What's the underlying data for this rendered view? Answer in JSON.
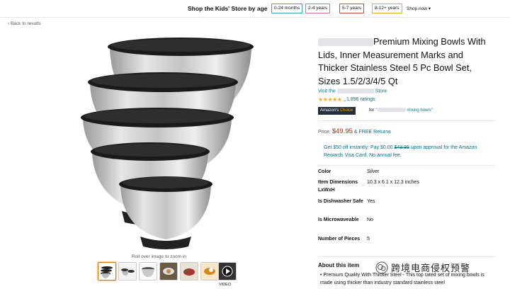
{
  "top_bar": {
    "label": "Shop the Kids' Store by age",
    "age_chips": [
      {
        "label": "0-24 months",
        "color": "#3aa2c9"
      },
      {
        "label": "2-4 years",
        "color": "#d86d9b"
      },
      {
        "label": "5-7 years",
        "color": "#e23c3c"
      },
      {
        "label": "8-12+ years",
        "color": "#e9b21c"
      }
    ],
    "shop_now": "Shop now ▾"
  },
  "back_link": "‹ Back to results",
  "gallery": {
    "roll_over_text": "Roll over image to zoom in",
    "thumbnail_count": 7,
    "video_label": "VIDEO"
  },
  "product": {
    "title": "Premium Mixing Bowls With Lids, Inner Measurement Marks and Thicker Stainless Steel 5 Pc Bowl Set, Sizes 1.5/2/3/4/5 Qt",
    "visit_prefix": "Visit the",
    "visit_suffix": "Store",
    "rating_stars": "★★★★★",
    "rating_value": 5,
    "rating_chevron": "⌄",
    "ratings_count": "1,896 ratings",
    "choice_badge_prefix": "Amazon's",
    "choice_badge_suffix": "Choice",
    "choice_for": "for",
    "choice_link": "mixing bowls\"",
    "price_label": "Price:",
    "price": "$49.95",
    "free_returns": "& FREE Returns",
    "promo_part1": "Get $50 off instantly: Pay $0.00",
    "promo_strike": "$49.95",
    "promo_part2": "upon approval for the Amazon Rewards Visa Card. No annual fee."
  },
  "specs": [
    {
      "label": "Color",
      "value": "Silver"
    },
    {
      "label": "Item Dimensions LxWxH",
      "value": "10.3 x 6.1 x 12.3 inches"
    },
    {
      "label": "Is Dishwasher Safe",
      "value": "Yes"
    },
    {
      "label": "Is Microwaveable",
      "value": "No"
    },
    {
      "label": "Number of Pieces",
      "value": "5"
    }
  ],
  "about": {
    "title": "About this item",
    "bullet": "• Premium Quality With Thicker Steel - This top rated set of mixing bowls is made using thicker than industry standard stainless steel"
  },
  "watermark": {
    "text": "跨境电商侵权预警"
  }
}
